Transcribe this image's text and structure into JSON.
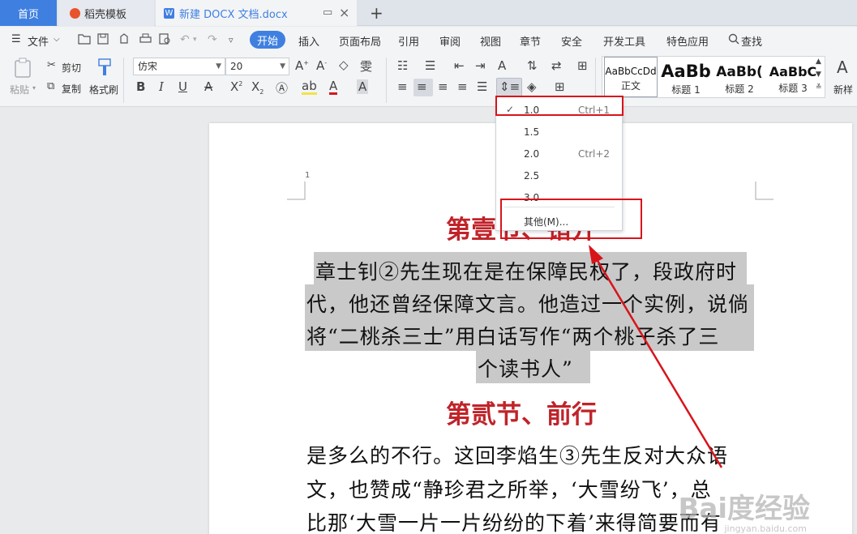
{
  "tabs": {
    "home": "首页",
    "daoke": "稻壳模板",
    "doc": "新建 DOCX 文档.docx",
    "doc_icon": "W",
    "new_tab": "+"
  },
  "menubar": {
    "file": "文件",
    "items": [
      "开始",
      "插入",
      "页面布局",
      "引用",
      "审阅",
      "视图",
      "章节",
      "安全",
      "开发工具",
      "特色应用"
    ],
    "search": "查找"
  },
  "ribbon": {
    "paste": "粘贴",
    "cut": "剪切",
    "copy": "复制",
    "format_painter": "格式刷",
    "font_name": "仿宋",
    "font_size": "20",
    "styles": [
      {
        "sample": "AaBbCcDd",
        "name": "正文"
      },
      {
        "sample": "AaBb",
        "name": "标题 1"
      },
      {
        "sample": "AaBb(",
        "name": "标题 2"
      },
      {
        "sample": "AaBbC",
        "name": "标题 3"
      }
    ],
    "new_style": "新样"
  },
  "line_spacing_menu": {
    "items": [
      {
        "value": "1.0",
        "shortcut": "Ctrl+1",
        "checked": true
      },
      {
        "value": "1.5",
        "shortcut": ""
      },
      {
        "value": "2.0",
        "shortcut": "Ctrl+2"
      },
      {
        "value": "2.5",
        "shortcut": ""
      },
      {
        "value": "3.0",
        "shortcut": ""
      }
    ],
    "other": "其他(M)..."
  },
  "document": {
    "page_number": "1",
    "heading1": "第壹节、错开",
    "para1": [
      "章士钊②先生现在是在保障民权了，段政府时",
      "代，他还曾经保障文言。他造过一个实例，说倘",
      "将“二桃杀三士”用白话写作“两个桃子杀了三",
      "个读书人”"
    ],
    "heading2": "第贰节、前行",
    "para2": [
      "是多么的不行。这回李焰生③先生反对大众语",
      "文，也赞成“静珍君之所举，‘大雪纷飞’，总",
      "比那‘大雪一片一片纷纷的下着’来得简要而有"
    ]
  },
  "watermark": {
    "brand": "Bai度经验",
    "url": "jingyan.baidu.com"
  },
  "colors": {
    "accent": "#3f7fe0",
    "heading": "#c0232a",
    "annotation": "#d8141b",
    "highlight": "#c9c9c9"
  }
}
